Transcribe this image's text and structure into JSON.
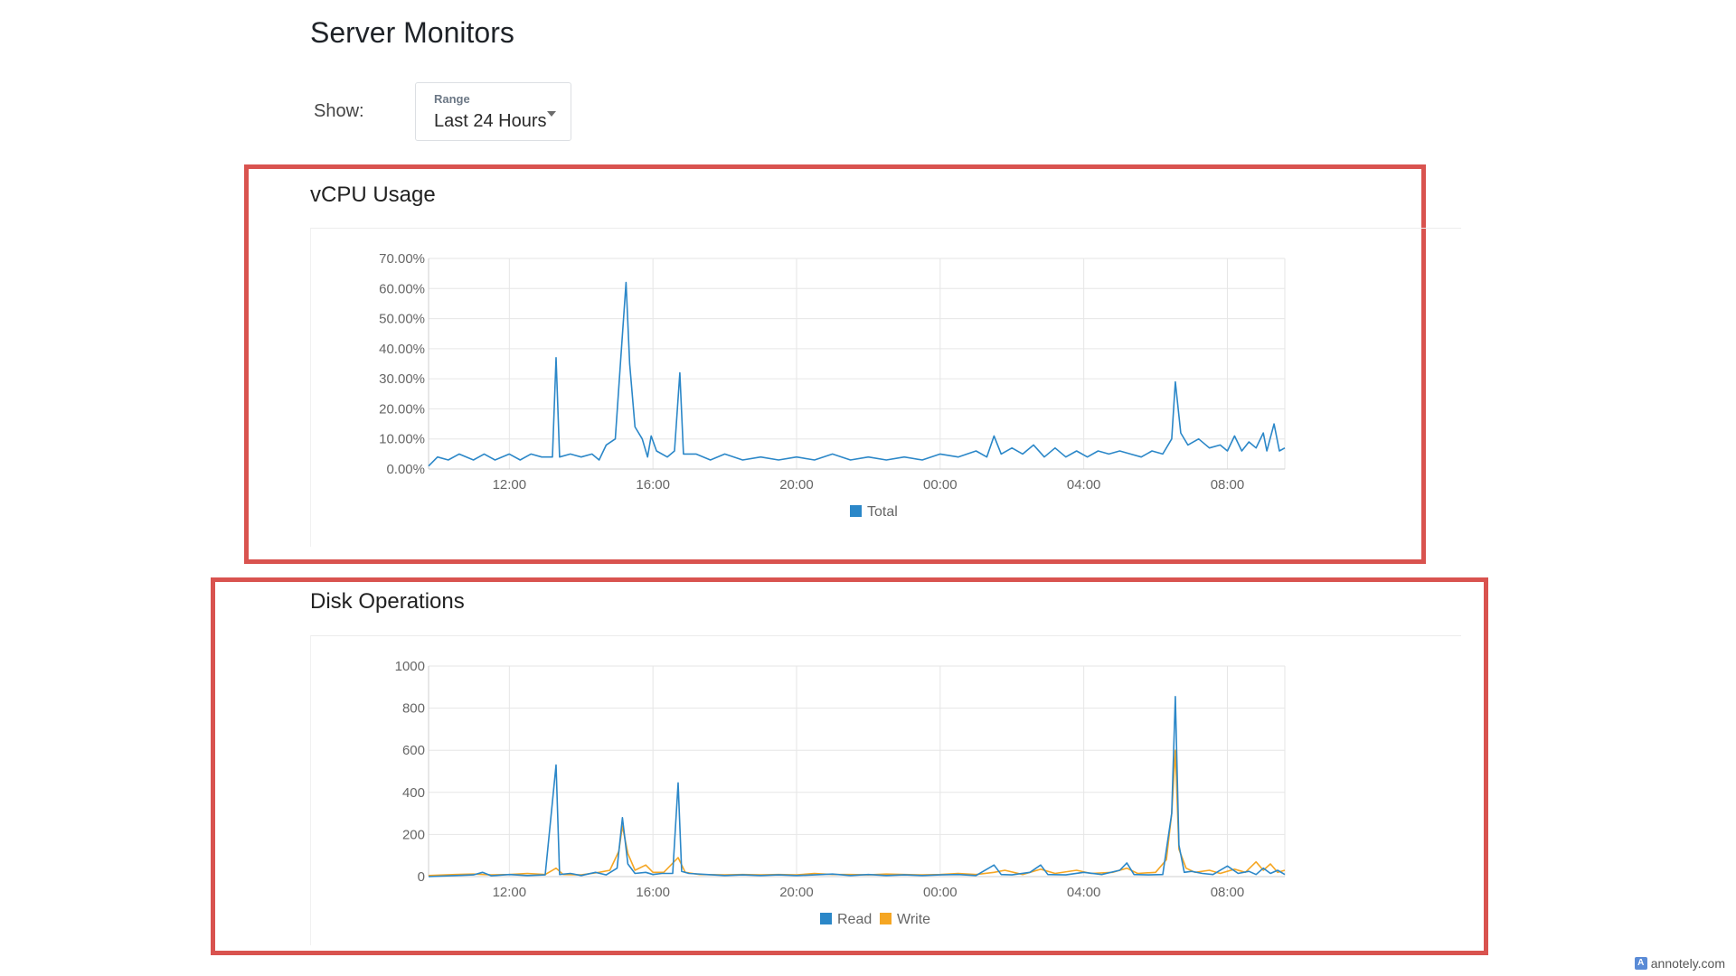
{
  "page": {
    "title": "Server Monitors"
  },
  "filter": {
    "show_label": "Show:",
    "range_caption": "Range",
    "range_value": "Last 24 Hours"
  },
  "sections": {
    "vcpu_title": "vCPU Usage",
    "disk_title": "Disk Operations"
  },
  "colors": {
    "read_series": "#2b87c8",
    "write_series": "#f5a623",
    "annotation": "#d9534f",
    "grid": "#e6e6e6"
  },
  "watermark": {
    "text": "annotely.com",
    "icon": "annotely-logo-icon"
  },
  "chart_data": [
    {
      "type": "line",
      "title": "",
      "xlabel": "",
      "ylabel": "",
      "x_ticks": [
        "12:00",
        "16:00",
        "20:00",
        "00:00",
        "04:00",
        "08:00"
      ],
      "x_range_hours": [
        9.75,
        33.6
      ],
      "y_ticks": [
        "0.00%",
        "10.00%",
        "20.00%",
        "30.00%",
        "40.00%",
        "50.00%",
        "60.00%",
        "70.00%"
      ],
      "ylim": [
        0,
        70
      ],
      "grid": true,
      "legend": "bottom-center",
      "series": [
        {
          "name": "Total",
          "color": "#2b87c8",
          "points": [
            [
              9.75,
              1
            ],
            [
              10.0,
              4
            ],
            [
              10.3,
              3
            ],
            [
              10.6,
              5
            ],
            [
              11.0,
              3
            ],
            [
              11.3,
              5
            ],
            [
              11.6,
              3
            ],
            [
              12.0,
              5
            ],
            [
              12.3,
              3
            ],
            [
              12.6,
              5
            ],
            [
              12.9,
              4
            ],
            [
              13.2,
              4
            ],
            [
              13.3,
              37
            ],
            [
              13.4,
              4
            ],
            [
              13.7,
              5
            ],
            [
              14.0,
              4
            ],
            [
              14.3,
              5
            ],
            [
              14.5,
              3
            ],
            [
              14.7,
              8
            ],
            [
              14.95,
              10
            ],
            [
              15.1,
              36
            ],
            [
              15.25,
              62
            ],
            [
              15.35,
              35
            ],
            [
              15.5,
              14
            ],
            [
              15.7,
              10
            ],
            [
              15.85,
              4
            ],
            [
              15.95,
              11
            ],
            [
              16.1,
              6
            ],
            [
              16.4,
              4
            ],
            [
              16.6,
              6
            ],
            [
              16.75,
              32
            ],
            [
              16.85,
              5
            ],
            [
              17.2,
              5
            ],
            [
              17.6,
              3
            ],
            [
              18.0,
              5
            ],
            [
              18.5,
              3
            ],
            [
              19.0,
              4
            ],
            [
              19.5,
              3
            ],
            [
              20.0,
              4
            ],
            [
              20.5,
              3
            ],
            [
              21.0,
              5
            ],
            [
              21.5,
              3
            ],
            [
              22.0,
              4
            ],
            [
              22.5,
              3
            ],
            [
              23.0,
              4
            ],
            [
              23.5,
              3
            ],
            [
              24.0,
              5
            ],
            [
              24.5,
              4
            ],
            [
              25.0,
              6
            ],
            [
              25.3,
              4
            ],
            [
              25.5,
              11
            ],
            [
              25.7,
              5
            ],
            [
              26.0,
              7
            ],
            [
              26.3,
              5
            ],
            [
              26.6,
              8
            ],
            [
              26.9,
              4
            ],
            [
              27.2,
              7
            ],
            [
              27.5,
              4
            ],
            [
              27.8,
              6
            ],
            [
              28.1,
              4
            ],
            [
              28.4,
              6
            ],
            [
              28.7,
              5
            ],
            [
              29.0,
              6
            ],
            [
              29.3,
              5
            ],
            [
              29.6,
              4
            ],
            [
              29.9,
              6
            ],
            [
              30.2,
              5
            ],
            [
              30.45,
              10
            ],
            [
              30.55,
              29
            ],
            [
              30.7,
              12
            ],
            [
              30.9,
              8
            ],
            [
              31.2,
              10
            ],
            [
              31.5,
              7
            ],
            [
              31.8,
              8
            ],
            [
              32.0,
              6
            ],
            [
              32.2,
              11
            ],
            [
              32.4,
              6
            ],
            [
              32.6,
              9
            ],
            [
              32.8,
              7
            ],
            [
              33.0,
              12
            ],
            [
              33.1,
              6
            ],
            [
              33.3,
              15
            ],
            [
              33.45,
              6
            ],
            [
              33.6,
              7
            ]
          ]
        }
      ]
    },
    {
      "type": "line",
      "title": "",
      "xlabel": "",
      "ylabel": "",
      "x_ticks": [
        "12:00",
        "16:00",
        "20:00",
        "00:00",
        "04:00",
        "08:00"
      ],
      "x_range_hours": [
        9.75,
        33.6
      ],
      "y_ticks": [
        "0",
        "200",
        "400",
        "600",
        "800",
        "1000"
      ],
      "ylim": [
        0,
        1000
      ],
      "grid": true,
      "legend": "bottom-center",
      "series": [
        {
          "name": "Read",
          "color": "#2b87c8",
          "points": [
            [
              9.75,
              0
            ],
            [
              10.5,
              5
            ],
            [
              11.0,
              8
            ],
            [
              11.25,
              20
            ],
            [
              11.5,
              4
            ],
            [
              12.0,
              10
            ],
            [
              12.5,
              5
            ],
            [
              13.0,
              8
            ],
            [
              13.3,
              530
            ],
            [
              13.4,
              10
            ],
            [
              13.7,
              15
            ],
            [
              14.0,
              5
            ],
            [
              14.4,
              20
            ],
            [
              14.7,
              8
            ],
            [
              15.0,
              40
            ],
            [
              15.15,
              280
            ],
            [
              15.3,
              60
            ],
            [
              15.5,
              15
            ],
            [
              15.8,
              20
            ],
            [
              16.0,
              10
            ],
            [
              16.25,
              15
            ],
            [
              16.55,
              15
            ],
            [
              16.7,
              445
            ],
            [
              16.8,
              25
            ],
            [
              17.0,
              15
            ],
            [
              17.5,
              10
            ],
            [
              18.0,
              5
            ],
            [
              18.5,
              8
            ],
            [
              19.0,
              5
            ],
            [
              19.5,
              8
            ],
            [
              20.0,
              5
            ],
            [
              20.5,
              8
            ],
            [
              21.0,
              12
            ],
            [
              21.5,
              5
            ],
            [
              22.0,
              10
            ],
            [
              22.5,
              5
            ],
            [
              23.0,
              8
            ],
            [
              23.5,
              5
            ],
            [
              24.0,
              8
            ],
            [
              24.5,
              10
            ],
            [
              25.0,
              5
            ],
            [
              25.5,
              55
            ],
            [
              25.7,
              10
            ],
            [
              26.0,
              8
            ],
            [
              26.5,
              20
            ],
            [
              26.8,
              55
            ],
            [
              27.0,
              10
            ],
            [
              27.5,
              8
            ],
            [
              28.0,
              20
            ],
            [
              28.5,
              10
            ],
            [
              29.0,
              30
            ],
            [
              29.2,
              65
            ],
            [
              29.4,
              10
            ],
            [
              29.8,
              8
            ],
            [
              30.2,
              10
            ],
            [
              30.45,
              300
            ],
            [
              30.55,
              855
            ],
            [
              30.65,
              150
            ],
            [
              30.8,
              20
            ],
            [
              31.0,
              25
            ],
            [
              31.3,
              15
            ],
            [
              31.6,
              10
            ],
            [
              32.0,
              50
            ],
            [
              32.3,
              15
            ],
            [
              32.6,
              25
            ],
            [
              32.8,
              10
            ],
            [
              33.0,
              40
            ],
            [
              33.2,
              15
            ],
            [
              33.4,
              30
            ],
            [
              33.6,
              10
            ]
          ]
        },
        {
          "name": "Write",
          "color": "#f5a623",
          "points": [
            [
              9.75,
              5
            ],
            [
              10.5,
              10
            ],
            [
              11.0,
              12
            ],
            [
              11.5,
              8
            ],
            [
              12.0,
              10
            ],
            [
              12.5,
              15
            ],
            [
              13.0,
              10
            ],
            [
              13.3,
              40
            ],
            [
              13.5,
              10
            ],
            [
              14.0,
              8
            ],
            [
              14.5,
              20
            ],
            [
              14.8,
              30
            ],
            [
              15.05,
              120
            ],
            [
              15.15,
              240
            ],
            [
              15.3,
              110
            ],
            [
              15.5,
              30
            ],
            [
              15.8,
              55
            ],
            [
              16.0,
              20
            ],
            [
              16.3,
              20
            ],
            [
              16.7,
              90
            ],
            [
              16.9,
              20
            ],
            [
              17.3,
              10
            ],
            [
              18.0,
              8
            ],
            [
              18.5,
              10
            ],
            [
              19.0,
              8
            ],
            [
              19.5,
              10
            ],
            [
              20.0,
              8
            ],
            [
              20.5,
              15
            ],
            [
              21.0,
              10
            ],
            [
              21.5,
              10
            ],
            [
              22.0,
              8
            ],
            [
              22.5,
              12
            ],
            [
              23.0,
              10
            ],
            [
              23.5,
              8
            ],
            [
              24.0,
              10
            ],
            [
              24.5,
              15
            ],
            [
              25.0,
              10
            ],
            [
              25.5,
              20
            ],
            [
              25.8,
              30
            ],
            [
              26.3,
              10
            ],
            [
              26.8,
              35
            ],
            [
              27.2,
              15
            ],
            [
              27.8,
              30
            ],
            [
              28.2,
              15
            ],
            [
              28.8,
              20
            ],
            [
              29.2,
              40
            ],
            [
              29.5,
              15
            ],
            [
              30.0,
              20
            ],
            [
              30.3,
              80
            ],
            [
              30.45,
              300
            ],
            [
              30.55,
              600
            ],
            [
              30.65,
              130
            ],
            [
              30.85,
              40
            ],
            [
              31.1,
              20
            ],
            [
              31.5,
              30
            ],
            [
              31.8,
              15
            ],
            [
              32.2,
              35
            ],
            [
              32.5,
              20
            ],
            [
              32.8,
              70
            ],
            [
              33.0,
              30
            ],
            [
              33.2,
              60
            ],
            [
              33.4,
              20
            ],
            [
              33.6,
              30
            ]
          ]
        }
      ]
    }
  ]
}
